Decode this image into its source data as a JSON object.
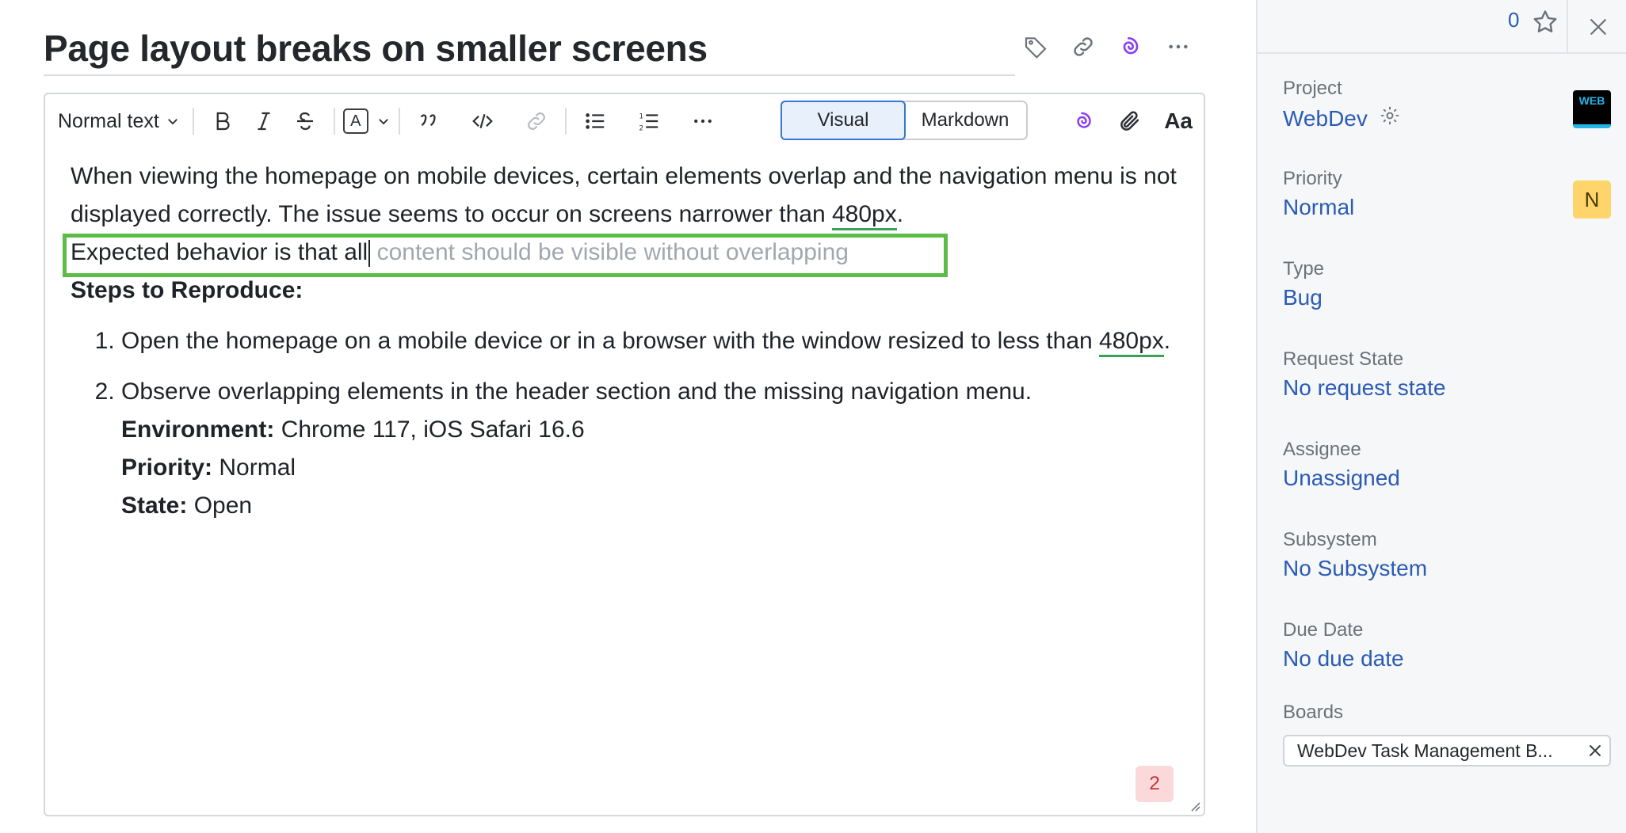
{
  "issue": {
    "title": "Page layout breaks on smaller screens"
  },
  "toolbar": {
    "text_style": "Normal text",
    "visual_label": "Visual",
    "markdown_label": "Markdown",
    "font_label": "Aa",
    "color_letter": "A"
  },
  "body": {
    "paragraph_part1": "When viewing the homepage on mobile devices, certain elements overlap and the navigation menu is not displayed correctly. The issue seems to occur on screens narrower than ",
    "paragraph_link1": "480px",
    "paragraph_part2": ".",
    "typed_text": "Expected behavior is that all",
    "suggestion_text": " content should be visible without overlapping",
    "steps_heading": "Steps to Reproduce:",
    "step1_part1": "Open the homepage on a mobile device or in a browser with the window resized to less than ",
    "step1_link": "480px",
    "step1_part2": ".",
    "step2_text": "Observe overlapping elements in the header section and the missing navigation menu.",
    "env_label": "Environment:",
    "env_value": " Chrome 117, iOS Safari 16.6",
    "priority_label": "Priority:",
    "priority_value": " Normal",
    "state_label": "State:",
    "state_value": " Open",
    "error_count": "2"
  },
  "sidebar": {
    "star_count": "0",
    "project_label": "Project",
    "project_value": "WebDev",
    "project_badge": "WEB",
    "priority_label": "Priority",
    "priority_value": "Normal",
    "priority_badge": "N",
    "type_label": "Type",
    "type_value": "Bug",
    "request_state_label": "Request State",
    "request_state_value": "No request state",
    "assignee_label": "Assignee",
    "assignee_value": "Unassigned",
    "subsystem_label": "Subsystem",
    "subsystem_value": "No Subsystem",
    "due_date_label": "Due Date",
    "due_date_value": "No due date",
    "boards_label": "Boards",
    "board_chip": "WebDev Task Management B..."
  },
  "colors": {
    "link": "#2a5bb5",
    "highlight": "#5cbd46",
    "ai_purple": "#8a3ff0"
  }
}
